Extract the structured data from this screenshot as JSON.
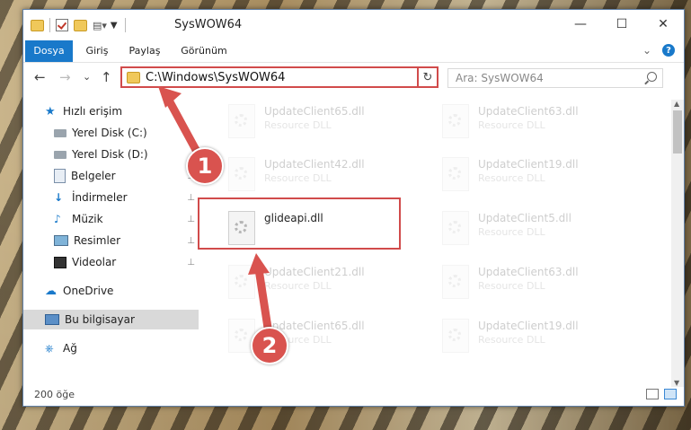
{
  "window": {
    "title": "SysWOW64",
    "minimize": "—",
    "maximize": "☐",
    "close": "✕"
  },
  "ribbon": {
    "tabs": [
      "Dosya",
      "Giriş",
      "Paylaş",
      "Görünüm"
    ],
    "collapse": "⌄",
    "help": "?"
  },
  "nav": {
    "back": "←",
    "forward": "→",
    "recent": "⌄",
    "up": "↑",
    "address": "C:\\Windows\\SysWOW64",
    "address_dropdown": "⌄",
    "refresh": "↻",
    "search_placeholder": "Ara: SysWOW64"
  },
  "sidebar": {
    "items": [
      {
        "label": "Hızlı erişim",
        "icon": "star-icon"
      },
      {
        "label": "Yerel Disk (C:)",
        "icon": "drive-icon"
      },
      {
        "label": "Yerel Disk (D:)",
        "icon": "drive-icon"
      },
      {
        "label": "Belgeler",
        "icon": "documents-icon"
      },
      {
        "label": "İndirmeler",
        "icon": "download-icon"
      },
      {
        "label": "Müzik",
        "icon": "music-icon"
      },
      {
        "label": "Resimler",
        "icon": "pictures-icon"
      },
      {
        "label": "Videolar",
        "icon": "videos-icon"
      },
      {
        "label": "OneDrive",
        "icon": "cloud-icon"
      },
      {
        "label": "Bu bilgisayar",
        "icon": "computer-icon"
      },
      {
        "label": "Ağ",
        "icon": "network-icon"
      }
    ],
    "pin": "📌"
  },
  "files": [
    {
      "name": "UpdateClient65.dll",
      "type": "Resource DLL"
    },
    {
      "name": "UpdateClient63.dll",
      "type": "Resource DLL"
    },
    {
      "name": "UpdateClient42.dll",
      "type": "Resource DLL"
    },
    {
      "name": "UpdateClient19.dll",
      "type": "Resource DLL"
    },
    {
      "name": "glideapi.dll",
      "type": ""
    },
    {
      "name": "UpdateClient5.dll",
      "type": "Resource DLL"
    },
    {
      "name": "UpdateClient21.dll",
      "type": "Resource DLL"
    },
    {
      "name": "UpdateClient63.dll",
      "type": "Resource DLL"
    },
    {
      "name": "UpdateClient65.dll",
      "type": "Resource DLL"
    },
    {
      "name": "UpdateClient19.dll",
      "type": "Resource DLL"
    }
  ],
  "status": {
    "count": "200 öğe"
  },
  "callouts": [
    "1",
    "2"
  ],
  "colors": {
    "accent": "#1979ca",
    "highlight": "#d14b4b"
  }
}
